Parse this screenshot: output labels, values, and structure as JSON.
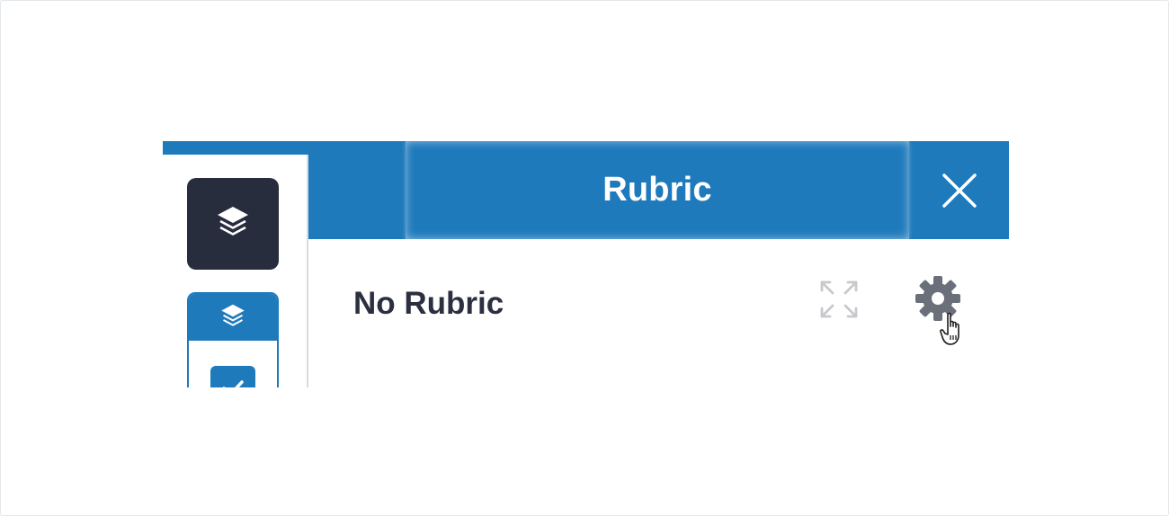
{
  "panel": {
    "title": "Rubric",
    "body_text": "No Rubric"
  },
  "icons": {
    "close": "close-icon",
    "layers": "layers-icon",
    "checkbox": "checkmark-icon",
    "expand": "expand-icon",
    "settings": "gear-icon",
    "cursor": "hand-pointer-icon"
  },
  "colors": {
    "accent": "#1f7abc",
    "dark_tile": "#282d3e",
    "text": "#2b2f3f",
    "icon_gray": "#6b6f7a"
  }
}
